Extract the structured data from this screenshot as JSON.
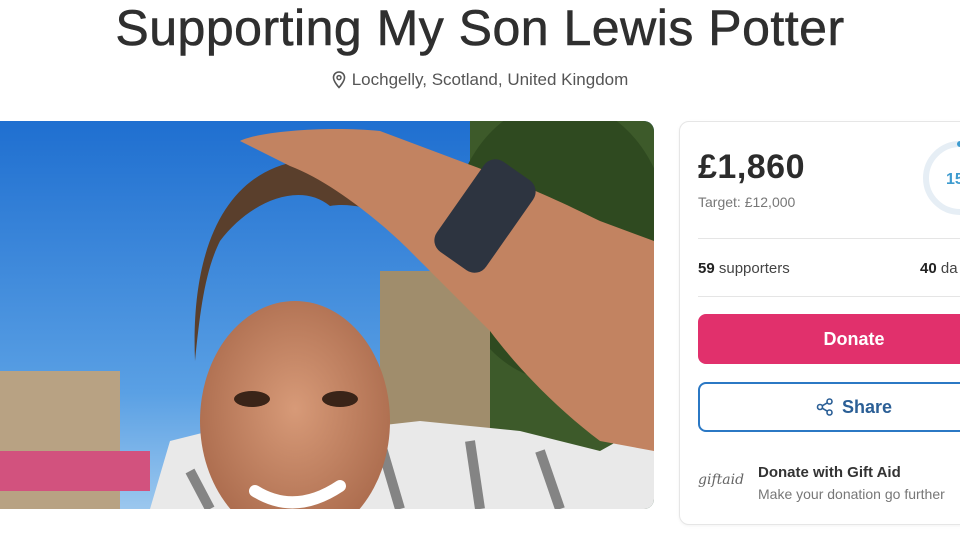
{
  "page": {
    "title": "Supporting My Son Lewis Potter",
    "location": "Lochgelly, Scotland, United Kingdom"
  },
  "icons": {
    "location": "location-pin-icon",
    "share": "share-icon"
  },
  "colors": {
    "donate": "#e1306c",
    "share_border": "#2b78c4",
    "ring": "#3e9bcf"
  },
  "fundraiser": {
    "amount_raised": "£1,860",
    "target": "Target: £12,000",
    "progress_label": "15",
    "progress_fraction": 0.155,
    "supporters_count": "59",
    "supporters_label": "supporters",
    "days_count": "40",
    "days_label": "da",
    "donate_label": "Donate",
    "share_label": "Share"
  },
  "gift_aid": {
    "logo_text": "giftaid",
    "title": "Donate with Gift Aid",
    "subtitle": "Make your donation go further"
  }
}
